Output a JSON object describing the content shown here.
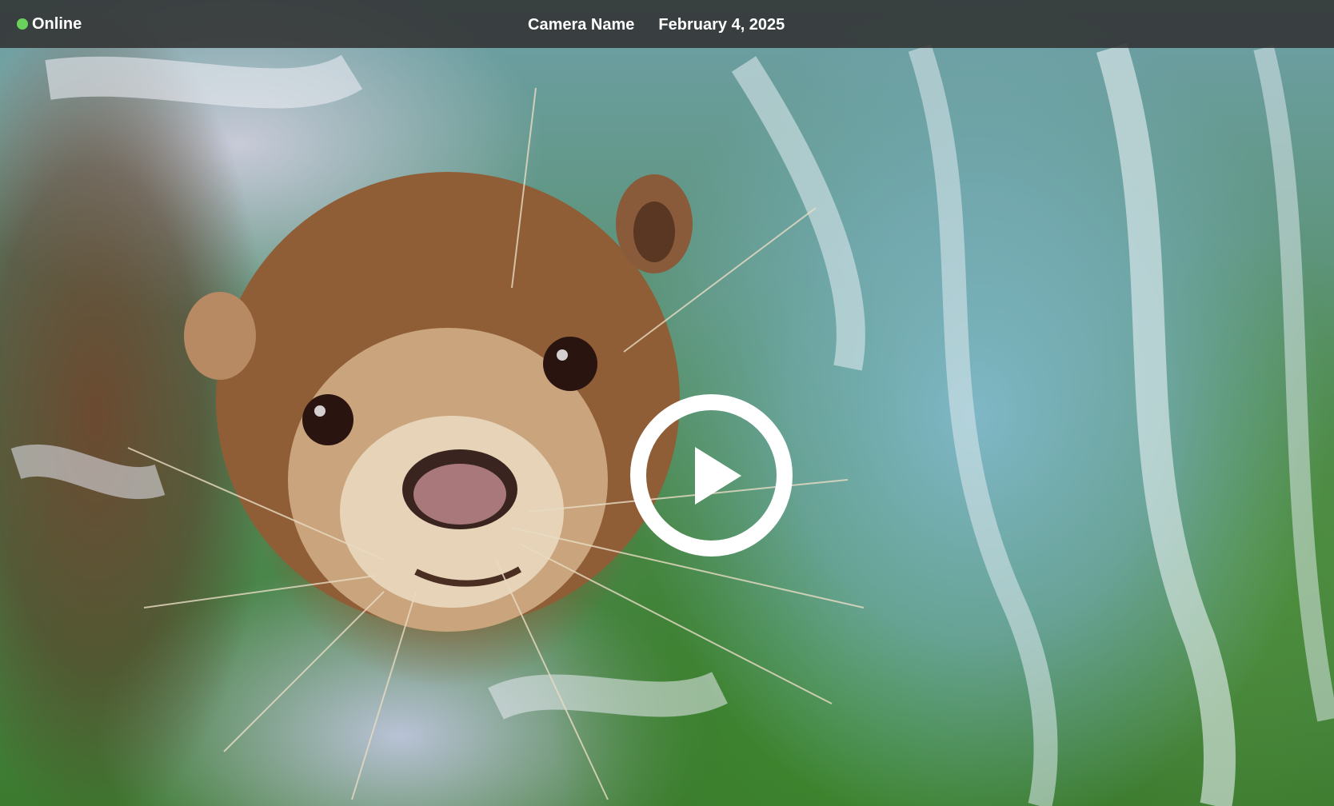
{
  "status": {
    "label": "Online",
    "dot_color": "#6ad25c",
    "icon": "status-dot-icon"
  },
  "camera": {
    "name": "Camera Name",
    "date": "February 4, 2025"
  },
  "player": {
    "play_icon": "play-icon",
    "state": "paused"
  },
  "colors": {
    "topbar_bg": "rgba(50,50,50,0.88)",
    "text": "#ffffff"
  }
}
